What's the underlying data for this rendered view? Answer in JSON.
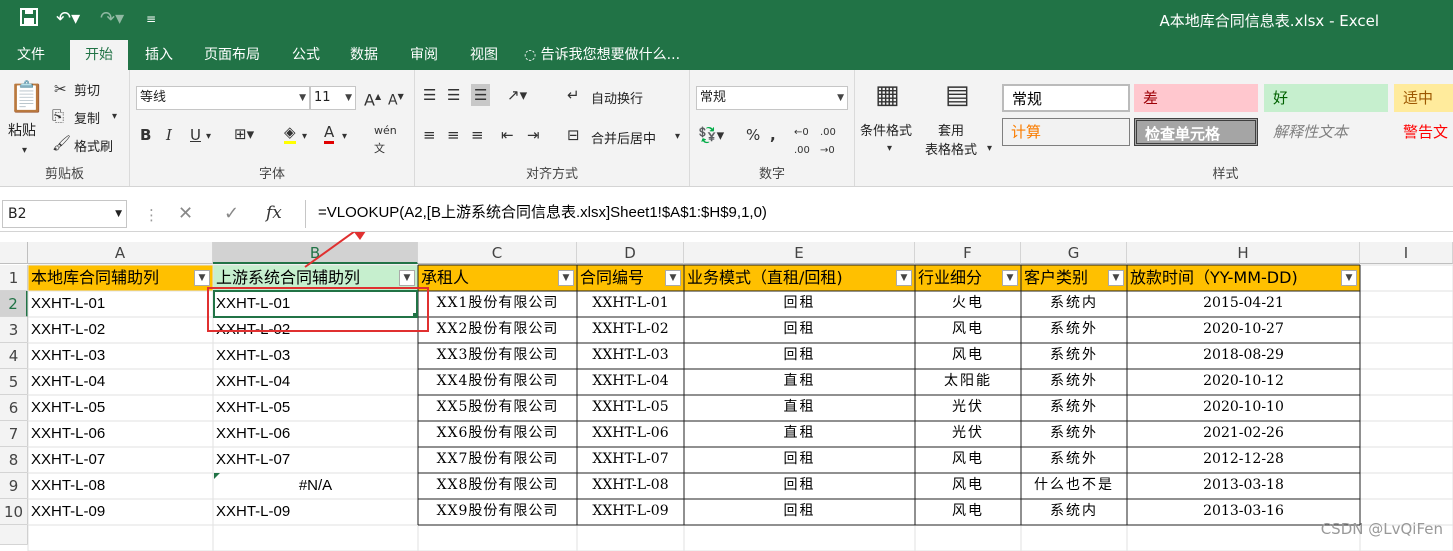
{
  "app": {
    "title": "A本地库合同信息表.xlsx - Excel"
  },
  "tabs": [
    "文件",
    "开始",
    "插入",
    "页面布局",
    "公式",
    "数据",
    "审阅",
    "视图",
    "告诉我您想要做什么..."
  ],
  "ribbon": {
    "clipboard": {
      "label": "剪贴板",
      "paste": "粘贴",
      "cut": "剪切",
      "copy": "复制",
      "painter": "格式刷"
    },
    "font": {
      "label": "字体",
      "name": "等线",
      "size": "11"
    },
    "align": {
      "label": "对齐方式",
      "wrap": "自动换行",
      "merge": "合并后居中"
    },
    "number": {
      "label": "数字",
      "format": "常规"
    },
    "cond": "条件格式",
    "table": "套用\n表格格式",
    "styles": {
      "label": "样式",
      "items": [
        "常规",
        "差",
        "好",
        "适中",
        "计算",
        "检查单元格",
        "解释性文本",
        "警告文"
      ]
    }
  },
  "formula_bar": {
    "name_box": "B2",
    "formula": "=VLOOKUP(A2,[B上游系统合同信息表.xlsx]Sheet1!$A$1:$H$9,1,0)"
  },
  "columns": [
    "A",
    "B",
    "C",
    "D",
    "E",
    "F",
    "G",
    "H",
    "I"
  ],
  "rows": [
    "1",
    "2",
    "3",
    "4",
    "5",
    "6",
    "7",
    "8",
    "9",
    "10"
  ],
  "headers": [
    "本地库合同辅助列",
    "上游系统合同辅助列",
    "承租人",
    "合同编号",
    "业务模式（直租/回租)",
    "行业细分",
    "客户类别",
    "放款时间（YY-MM-DD)"
  ],
  "colA": [
    "XXHT-L-01",
    "XXHT-L-02",
    "XXHT-L-03",
    "XXHT-L-04",
    "XXHT-L-05",
    "XXHT-L-06",
    "XXHT-L-07",
    "XXHT-L-08",
    "XXHT-L-09"
  ],
  "colB": [
    "XXHT-L-01",
    "XXHT-L-02",
    "XXHT-L-03",
    "XXHT-L-04",
    "XXHT-L-05",
    "XXHT-L-06",
    "XXHT-L-07",
    "#N/A",
    "XXHT-L-09"
  ],
  "table": [
    [
      "XX1股份有限公司",
      "XXHT-L-01",
      "回租",
      "火电",
      "系统内",
      "2015-04-21"
    ],
    [
      "XX2股份有限公司",
      "XXHT-L-02",
      "回租",
      "风电",
      "系统外",
      "2020-10-27"
    ],
    [
      "XX3股份有限公司",
      "XXHT-L-03",
      "回租",
      "风电",
      "系统外",
      "2018-08-29"
    ],
    [
      "XX4股份有限公司",
      "XXHT-L-04",
      "直租",
      "太阳能",
      "系统外",
      "2020-10-12"
    ],
    [
      "XX5股份有限公司",
      "XXHT-L-05",
      "直租",
      "光伏",
      "系统外",
      "2020-10-10"
    ],
    [
      "XX6股份有限公司",
      "XXHT-L-06",
      "直租",
      "光伏",
      "系统外",
      "2021-02-26"
    ],
    [
      "XX7股份有限公司",
      "XXHT-L-07",
      "回租",
      "风电",
      "系统外",
      "2012-12-28"
    ],
    [
      "XX8股份有限公司",
      "XXHT-L-08",
      "回租",
      "风电",
      "什么也不是",
      "2013-03-18"
    ],
    [
      "XX9股份有限公司",
      "XXHT-L-09",
      "回租",
      "风电",
      "系统内",
      "2013-03-16"
    ]
  ],
  "watermark": "CSDN @LvQiFen",
  "colors": {
    "excel_green": "#217346",
    "header_fill": "#ffc000",
    "header_b_fill": "#c6efce",
    "bad_fill": "#ffc7ce",
    "good_fill": "#c6efce",
    "neutral_fill": "#ffeb9c",
    "annotation": "#e03030"
  }
}
